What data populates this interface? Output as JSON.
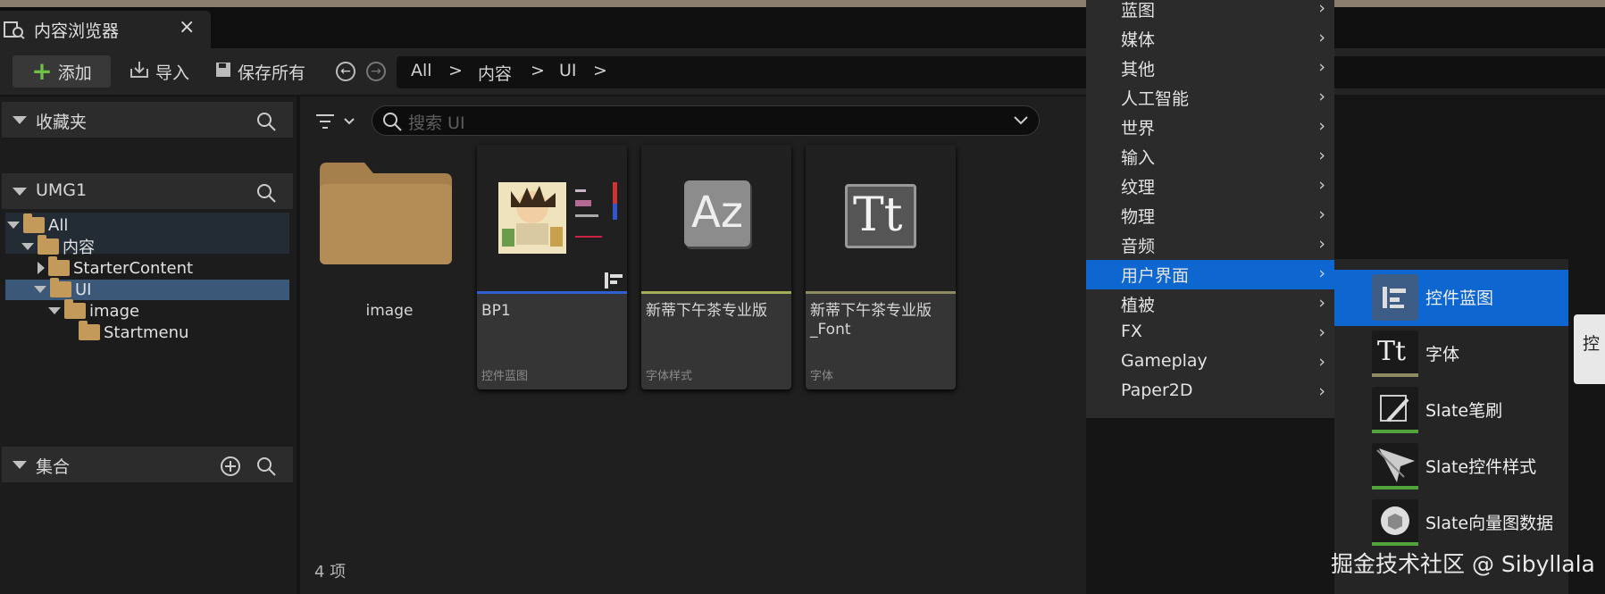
{
  "tab": {
    "title": "内容浏览器",
    "close": "×"
  },
  "toolbar": {
    "add_label": "添加",
    "import_label": "导入",
    "save_all_label": "保存所有",
    "breadcrumb": [
      "All",
      "内容",
      "UI"
    ],
    "separator": ">"
  },
  "left_panel": {
    "favorites_title": "收藏夹",
    "project_title": "UMG1",
    "collections_title": "集合",
    "tree": [
      {
        "label": "All",
        "expanded": true
      },
      {
        "label": "内容",
        "expanded": true
      },
      {
        "label": "StarterContent",
        "expanded": false
      },
      {
        "label": "UI",
        "expanded": true,
        "selected": true
      },
      {
        "label": "image",
        "expanded": true
      },
      {
        "label": "Startmenu"
      }
    ]
  },
  "main": {
    "search_placeholder": "搜索 UI",
    "item_count": "4 项",
    "assets": [
      {
        "name": "image",
        "type": "",
        "kind": "folder"
      },
      {
        "name": "BP1",
        "type": "控件蓝图",
        "bar_color": "#2f5fd0"
      },
      {
        "name": "新蒂下午茶专业版",
        "type": "字体样式",
        "bar_color": "#a6ad58"
      },
      {
        "name": "新蒂下午茶专业版_Font",
        "type": "字体",
        "bar_color": "#8e8a62"
      }
    ],
    "font_icon_text": "Tt",
    "fontface_icon_text": "Az"
  },
  "menu": {
    "items": [
      "蓝图",
      "媒体",
      "其他",
      "人工智能",
      "世界",
      "输入",
      "纹理",
      "物理",
      "音频",
      "用户界面",
      "植被",
      "FX",
      "Gameplay",
      "Paper2D"
    ],
    "selected_index": 9,
    "arrow": "›"
  },
  "submenu": {
    "items": [
      {
        "label": "控件蓝图",
        "icon": "widget-blueprint-icon",
        "line": "#2f5fd0"
      },
      {
        "label": "字体",
        "icon": "font-icon",
        "line": "#8e8a62"
      },
      {
        "label": "Slate笔刷",
        "icon": "slate-brush-icon",
        "line": "#52a33b"
      },
      {
        "label": "Slate控件样式",
        "icon": "slate-widget-style-icon",
        "line": "#52a33b"
      },
      {
        "label": "Slate向量图数据",
        "icon": "slate-vector-icon",
        "line": "#52a33b"
      }
    ],
    "selected_index": 0
  },
  "edge_button_text": "控",
  "watermark": "掘金技术社区 @ Sibyllala"
}
